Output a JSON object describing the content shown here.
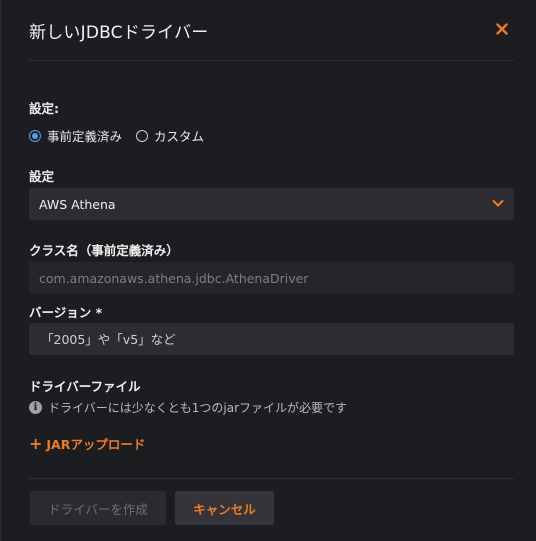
{
  "dialog": {
    "title": "新しいJDBCドライバー"
  },
  "settings_mode": {
    "label": "設定:",
    "options": [
      {
        "label": "事前定義済み",
        "checked": true
      },
      {
        "label": "カスタム",
        "checked": false
      }
    ]
  },
  "config": {
    "label": "設定",
    "selected": "AWS Athena"
  },
  "class_name": {
    "label": "クラス名（事前定義済み）",
    "value": "com.amazonaws.athena.jdbc.AthenaDriver"
  },
  "version": {
    "label": "バージョン *",
    "placeholder": "「2005」や「v5」など"
  },
  "driver_file": {
    "label": "ドライバーファイル",
    "info": "ドライバーには少なくとも1つのjarファイルが必要です",
    "upload_label": "JARアップロード"
  },
  "footer": {
    "create_label": "ドライバーを作成",
    "cancel_label": "キャンセル"
  },
  "colors": {
    "accent": "#f07c1e",
    "radio_selected": "#4aa3e8",
    "background": "#1c1d21"
  }
}
